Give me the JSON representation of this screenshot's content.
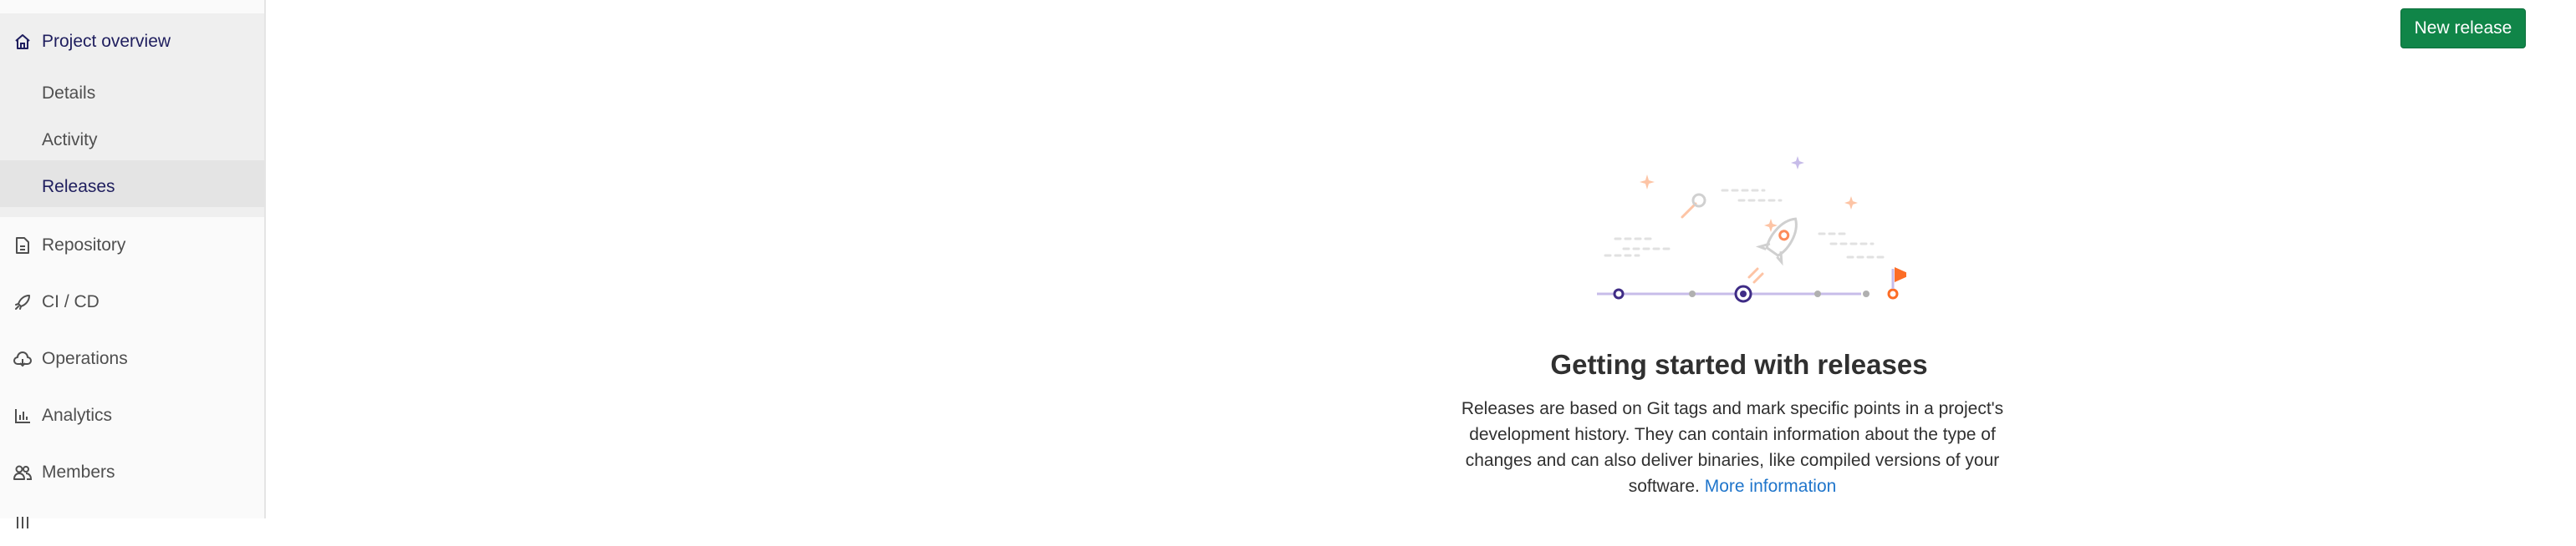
{
  "sidebar": {
    "project_overview": "Project overview",
    "sub_items": [
      "Details",
      "Activity",
      "Releases"
    ],
    "items": {
      "repository": "Repository",
      "cicd": "CI / CD",
      "operations": "Operations",
      "analytics": "Analytics",
      "members": "Members"
    }
  },
  "header": {
    "new_release_label": "New release"
  },
  "empty_state": {
    "title": "Getting started with releases",
    "description": "Releases are based on Git tags and mark specific points in a project's development history. They can contain information about the type of changes and can also deliver binaries, like compiled versions of your software.",
    "link_text": "More information"
  },
  "colors": {
    "accent": "#1f1e5e",
    "button": "#108548",
    "link": "#1f75cb",
    "illustration_orange": "#fc6d26",
    "illustration_purple": "#6b4fbb"
  }
}
